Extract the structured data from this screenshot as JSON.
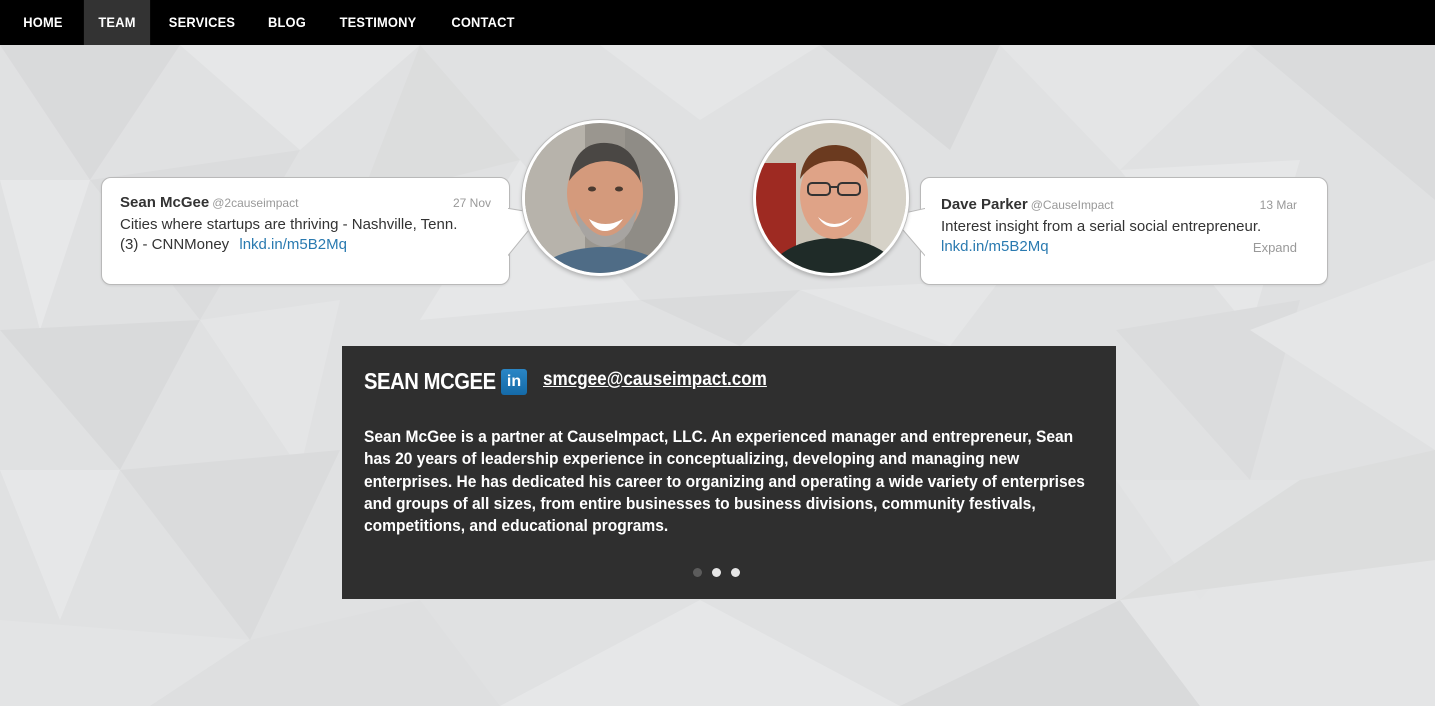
{
  "nav": {
    "items": [
      {
        "label": "HOME"
      },
      {
        "label": "TEAM"
      },
      {
        "label": "SERVICES"
      },
      {
        "label": "BLOG"
      },
      {
        "label": "TESTIMONY"
      },
      {
        "label": "CONTACT"
      }
    ],
    "active": "TEAM"
  },
  "tweets": [
    {
      "name": "Sean McGee",
      "handle": "@2causeimpact",
      "date": "27 Nov",
      "text_line1": "Cities where startups are thriving - Nashville, Tenn.",
      "text_line2": "(3) - CNNMoney",
      "link": "lnkd.in/m5B2Mq"
    },
    {
      "name": "Dave Parker",
      "handle": "@CauseImpact",
      "date": "13 Mar",
      "text_line1": "Interest insight from a serial social entrepreneur.",
      "link": "lnkd.in/m5B2Mq",
      "expand": "Expand"
    }
  ],
  "bio": {
    "name": "SEAN MCGEE",
    "linkedin_label": "in",
    "email": "smcgee@causeimpact.com",
    "text": "Sean McGee is a partner at CauseImpact, LLC.  An experienced manager and entrepreneur, Sean has 20 years of leadership experience in conceptualizing, developing and managing new enterprises. He has dedicated his career to organizing and operating a wide variety of enterprises and groups of all sizes, from entire businesses to business divisions, community festivals, competitions, and educational programs.",
    "carousel_active_index": 0,
    "carousel_count": 3
  },
  "colors": {
    "nav_bg": "#000000",
    "nav_active_bg": "#333333",
    "page_bg": "#e1e2e3",
    "panel_bg": "#2f2f2f",
    "link": "#2a7ab0",
    "linkedin": "#1f78b8"
  },
  "icons": {
    "linkedin": "linkedin-icon"
  }
}
